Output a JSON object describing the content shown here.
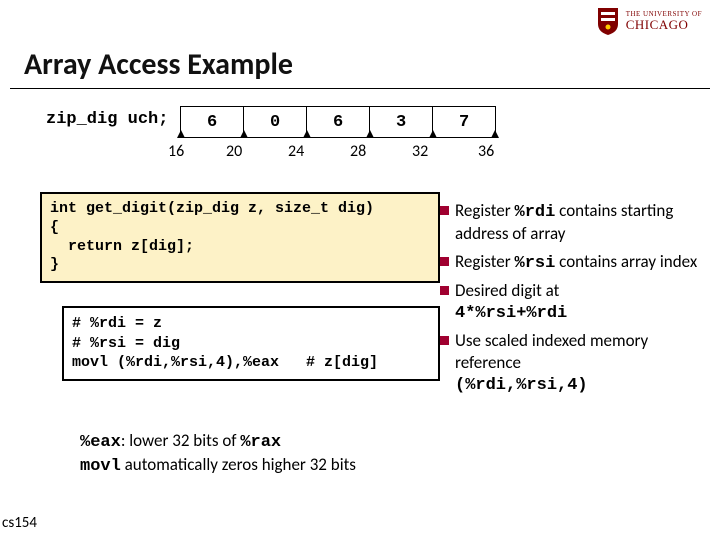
{
  "logo": {
    "line1": "THE UNIVERSITY OF",
    "line2": "CHICAGO"
  },
  "title": "Array Access Example",
  "array": {
    "decl": "zip_dig uch;",
    "values": [
      "6",
      "0",
      "6",
      "3",
      "7"
    ],
    "addresses": [
      "16",
      "20",
      "24",
      "28",
      "32",
      "36"
    ]
  },
  "code1": "int get_digit(zip_dig z, size_t dig)\n{\n  return z[dig];\n}",
  "code2": {
    "l1": "# %rdi = z",
    "l2": "# %rsi = dig",
    "l3a": "movl (%rdi,%rsi,4),%eax",
    "l3b": "   # z[dig]"
  },
  "bullets": {
    "b1a": "Register ",
    "b1m": "%rdi",
    "b1b": " contains starting address of array",
    "b2a": "Register ",
    "b2m": "%rsi",
    "b2b": " contains array index",
    "b3a": "Desired digit at ",
    "b3m": "4*%rsi+%rdi",
    "b4a": "Use scaled indexed memory reference ",
    "b4m": "(%rdi,%rsi,4)"
  },
  "footer": {
    "l1a": "%eax",
    "l1b": ": lower 32 bits of ",
    "l1c": "%rax",
    "l2a": "movl",
    "l2b": " automatically zeros higher 32 bits"
  },
  "page": "cs154"
}
